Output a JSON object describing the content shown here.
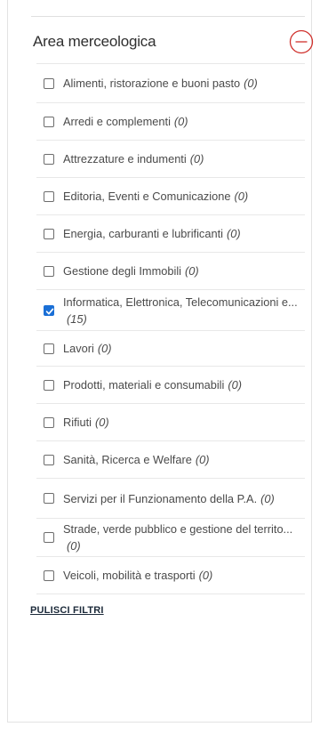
{
  "filter": {
    "title": "Area merceologica",
    "collapse_icon": "minus-circle-icon",
    "accent": "#d0312d",
    "checked_color": "#1a6fd6",
    "options": [
      {
        "label": "Alimenti, ristorazione e buoni pasto",
        "count": "(0)",
        "checked": false
      },
      {
        "label": "Arredi e complementi",
        "count": "(0)",
        "checked": false
      },
      {
        "label": "Attrezzature e indumenti",
        "count": "(0)",
        "checked": false
      },
      {
        "label": "Editoria, Eventi e Comunicazione",
        "count": "(0)",
        "checked": false
      },
      {
        "label": "Energia, carburanti e lubrificanti",
        "count": "(0)",
        "checked": false
      },
      {
        "label": "Gestione degli Immobili",
        "count": "(0)",
        "checked": false
      },
      {
        "label": "Informatica, Elettronica, Telecomunicazioni e...",
        "count": "(15)",
        "checked": true
      },
      {
        "label": "Lavori",
        "count": "(0)",
        "checked": false
      },
      {
        "label": "Prodotti, materiali e consumabili",
        "count": "(0)",
        "checked": false
      },
      {
        "label": "Rifiuti",
        "count": "(0)",
        "checked": false
      },
      {
        "label": "Sanità, Ricerca e Welfare",
        "count": "(0)",
        "checked": false
      },
      {
        "label": "Servizi per il Funzionamento della P.A.",
        "count": "(0)",
        "checked": false
      },
      {
        "label": "Strade, verde pubblico e gestione del territo...",
        "count": "(0)",
        "checked": false
      },
      {
        "label": "Veicoli, mobilità e trasporti",
        "count": "(0)",
        "checked": false
      }
    ],
    "clear_label": "PULISCI FILTRI"
  }
}
